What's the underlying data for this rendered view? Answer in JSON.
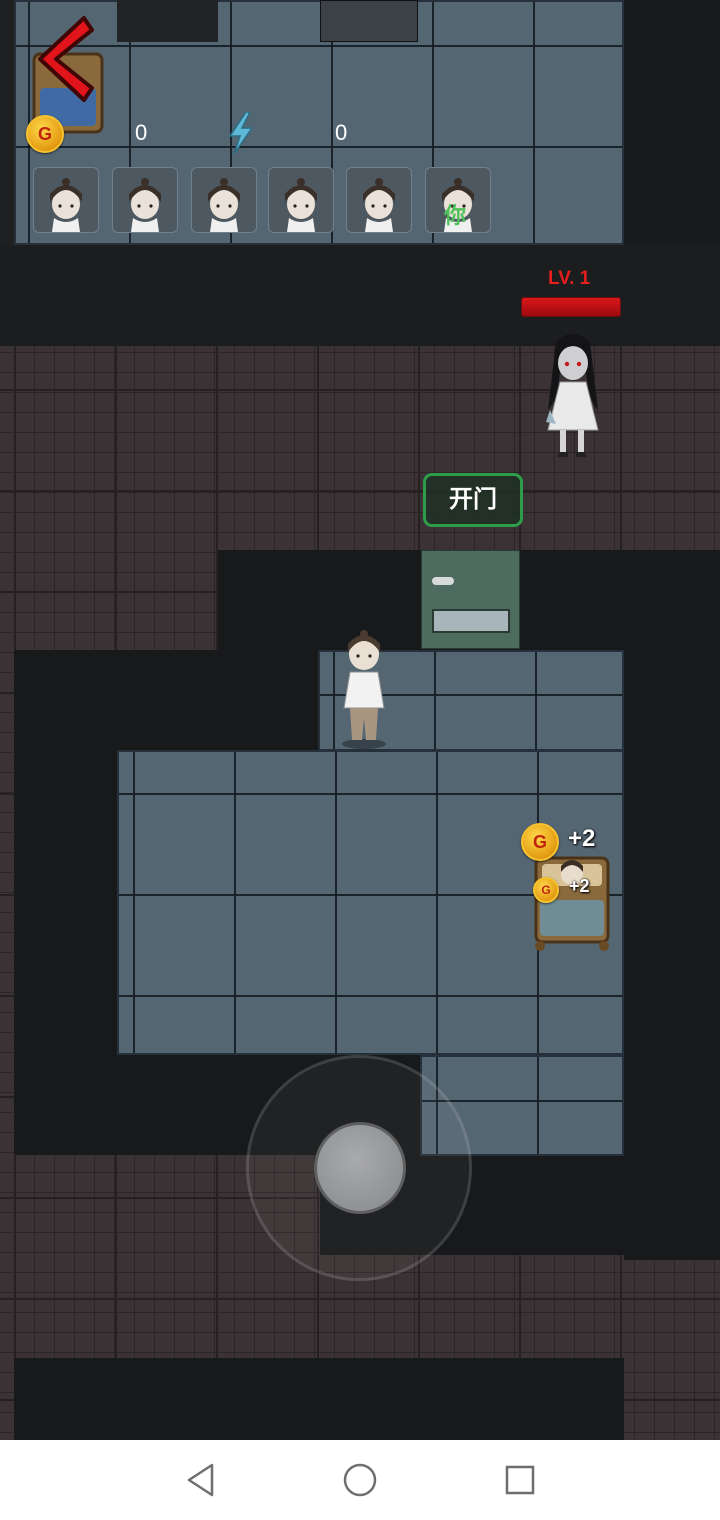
{
  "hud": {
    "gold_icon_letter": "G",
    "gold_value": "0",
    "energy_value": "0",
    "back_icon": "back-arrow-icon",
    "energy_icon": "lightning-icon",
    "player_slots": [
      {
        "name": "player-slot-1",
        "tag": ""
      },
      {
        "name": "player-slot-2",
        "tag": ""
      },
      {
        "name": "player-slot-3",
        "tag": ""
      },
      {
        "name": "player-slot-4",
        "tag": ""
      },
      {
        "name": "player-slot-5",
        "tag": ""
      },
      {
        "name": "player-slot-6",
        "tag": "你"
      }
    ]
  },
  "enemy": {
    "level_label": "LV. 1",
    "hp_fraction": 1.0
  },
  "map": {
    "open_door_label": "开门",
    "bed_reward_text": "+2",
    "bed_reward_small_text": "+2",
    "coin_letter": "G"
  },
  "colors": {
    "accent_green": "#2e9c4a",
    "hp_red": "#d8181c",
    "back_red": "#e0141a",
    "energy_blue": "#5fb8d6"
  },
  "navbar": {
    "back_icon": "triangle-back-icon",
    "home_icon": "circle-home-icon",
    "recents_icon": "square-recents-icon"
  }
}
